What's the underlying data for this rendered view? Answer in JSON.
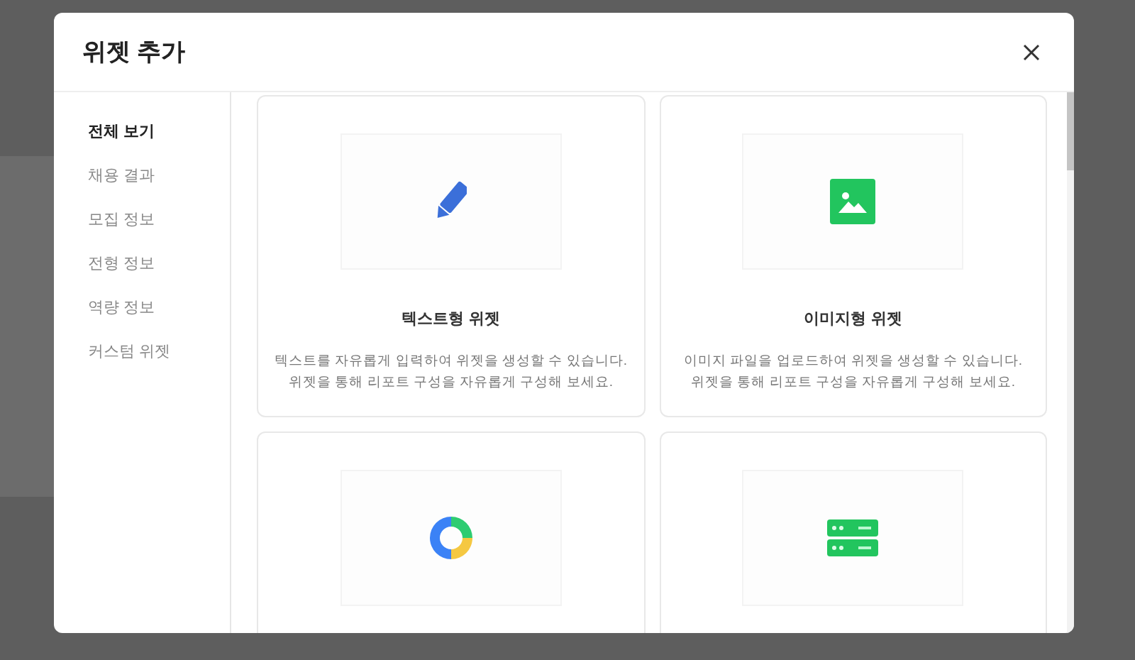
{
  "dialog": {
    "title": "위젯 추가"
  },
  "sidebar": {
    "items": [
      {
        "label": "전체 보기",
        "selected": true
      },
      {
        "label": "채용 결과",
        "selected": false
      },
      {
        "label": "모집 정보",
        "selected": false
      },
      {
        "label": "전형 정보",
        "selected": false
      },
      {
        "label": "역량 정보",
        "selected": false
      },
      {
        "label": "커스텀 위젯",
        "selected": false
      }
    ]
  },
  "widgets": [
    {
      "kind": "text",
      "title": "텍스트형 위젯",
      "description": [
        "텍스트를 자유롭게 입력하여 위젯을 생성할 수 있습니다.",
        "위젯을 통해 리포트 구성을 자유롭게 구성해 보세요."
      ]
    },
    {
      "kind": "image",
      "title": "이미지형 위젯",
      "description": [
        "이미지 파일을 업로드하여 위젯을 생성할 수 있습니다.",
        "위젯을 통해 리포트 구성을 자유롭게 구성해 보세요."
      ]
    },
    {
      "kind": "donut"
    },
    {
      "kind": "server"
    }
  ]
}
